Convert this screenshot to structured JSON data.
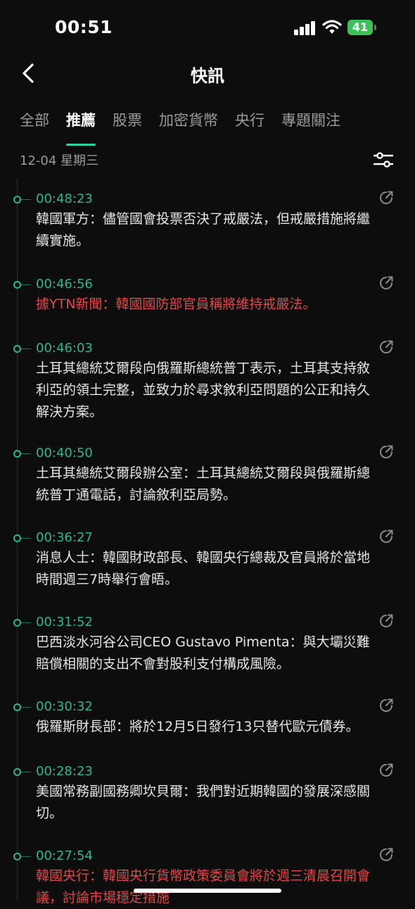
{
  "status_bar": {
    "time": "00:51",
    "battery_level": "41",
    "battery_color": "#3bc15a"
  },
  "header": {
    "title": "快訊"
  },
  "tabs": [
    {
      "label": "全部",
      "active": false
    },
    {
      "label": "推薦",
      "active": true
    },
    {
      "label": "股票",
      "active": false
    },
    {
      "label": "加密貨幣",
      "active": false
    },
    {
      "label": "央行",
      "active": false
    },
    {
      "label": "專題關注",
      "active": false
    }
  ],
  "date": {
    "label": "12-04 星期三"
  },
  "colors": {
    "accent": "#2fb78f",
    "highlight_red": "#e2484a",
    "background": "#0d0d0d"
  },
  "news": [
    {
      "time": "00:48:23",
      "text": "韓國軍方：儘管國會投票否決了戒嚴法，但戒嚴措施將繼續實施。",
      "highlight": false
    },
    {
      "time": "00:46:56",
      "text": "據YTN新聞：韓國國防部官員稱將維持戒嚴法。",
      "highlight": true
    },
    {
      "time": "00:46:03",
      "text": "土耳其總統艾爾段向俄羅斯總統普丁表示，土耳其支持敘利亞的領土完整，並致力於尋求敘利亞問題的公正和持久解決方案。",
      "highlight": false
    },
    {
      "time": "00:40:50",
      "text": "土耳其總統艾爾段辦公室：土耳其總統艾爾段與俄羅斯總統普丁通電話，討論敘利亞局勢。",
      "highlight": false
    },
    {
      "time": "00:36:27",
      "text": "消息人士：韓國財政部長、韓國央行總裁及官員將於當地時間週三7時舉行會晤。",
      "highlight": false
    },
    {
      "time": "00:31:52",
      "text": "巴西淡水河谷公司CEO Gustavo Pimenta：與大壩災難賠償相關的支出不會對股利支付構成風險。",
      "highlight": false
    },
    {
      "time": "00:30:32",
      "text": "俄羅斯財長部：將於12月5日發行13只替代歐元債券。",
      "highlight": false
    },
    {
      "time": "00:28:23",
      "text": "美國常務副國務卿坎貝爾：我們對近期韓國的發展深感關切。",
      "highlight": false
    },
    {
      "time": "00:27:54",
      "text": "韓國央行：韓國央行貨幣政策委員會將於週三清晨召開會議，討論市場穩定措施",
      "highlight": true
    }
  ]
}
